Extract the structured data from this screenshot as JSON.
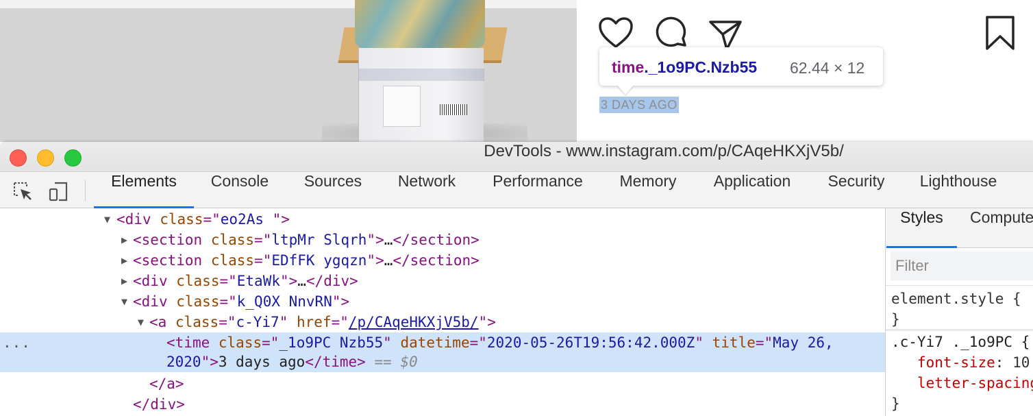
{
  "page": {
    "time_label": "3 DAYS AGO"
  },
  "tooltip": {
    "tag": "time",
    "classes": "._1o9PC.Nzb55",
    "size": "62.44 × 12"
  },
  "window": {
    "title": "DevTools - www.instagram.com/p/CAqeHKXjV5b/"
  },
  "tabs": [
    "Elements",
    "Console",
    "Sources",
    "Network",
    "Performance",
    "Memory",
    "Application",
    "Security",
    "Lighthouse"
  ],
  "active_tab": "Elements",
  "dom": {
    "r1_tag": "div",
    "r1_attr": "class",
    "r1_val": "eo2As ",
    "r2_tag": "section",
    "r2_attr": "class",
    "r2_val": "ltpMr Slqrh",
    "r2_close": "</section>",
    "r3_tag": "section",
    "r3_attr": "class",
    "r3_val": "EDfFK ygqzn",
    "r3_close": "</section>",
    "r4_tag": "div",
    "r4_attr": "class",
    "r4_val": "EtaWk",
    "r4_close": "</div>",
    "r5_tag": "div",
    "r5_attr": "class",
    "r5_val": "k_Q0X NnvRN",
    "r6_tag": "a",
    "r6_attr1": "class",
    "r6_val1": "c-Yi7",
    "r6_attr2": "href",
    "r6_val2": "/p/CAqeHKXjV5b/",
    "r7_tag": "time",
    "r7_attr1": "class",
    "r7_val1": "_1o9PC Nzb55",
    "r7_attr2": "datetime",
    "r7_val2": "2020-05-26T19:56:42.000Z",
    "r7_attr3": "title",
    "r7_val3a": "May 26,",
    "r8_val3b": "2020",
    "r8_text": "3 days ago",
    "r8_close": "</time>",
    "r8_eq": "==",
    "r8_dollar": "$0",
    "r9_close": "</a>",
    "r10_close": "</div>",
    "ellipsis": "…",
    "row_dots": "..."
  },
  "styles": {
    "tabs": [
      "Styles",
      "Computed"
    ],
    "filter_placeholder": "Filter",
    "element_style": "element.style {",
    "close_brace": "}",
    "rule_selector": ".c-Yi7 ._1o9PC {",
    "prop1_name": "font-size",
    "prop1_value": "10",
    "prop2_name": "letter-spacing",
    "rule_close": "}"
  }
}
